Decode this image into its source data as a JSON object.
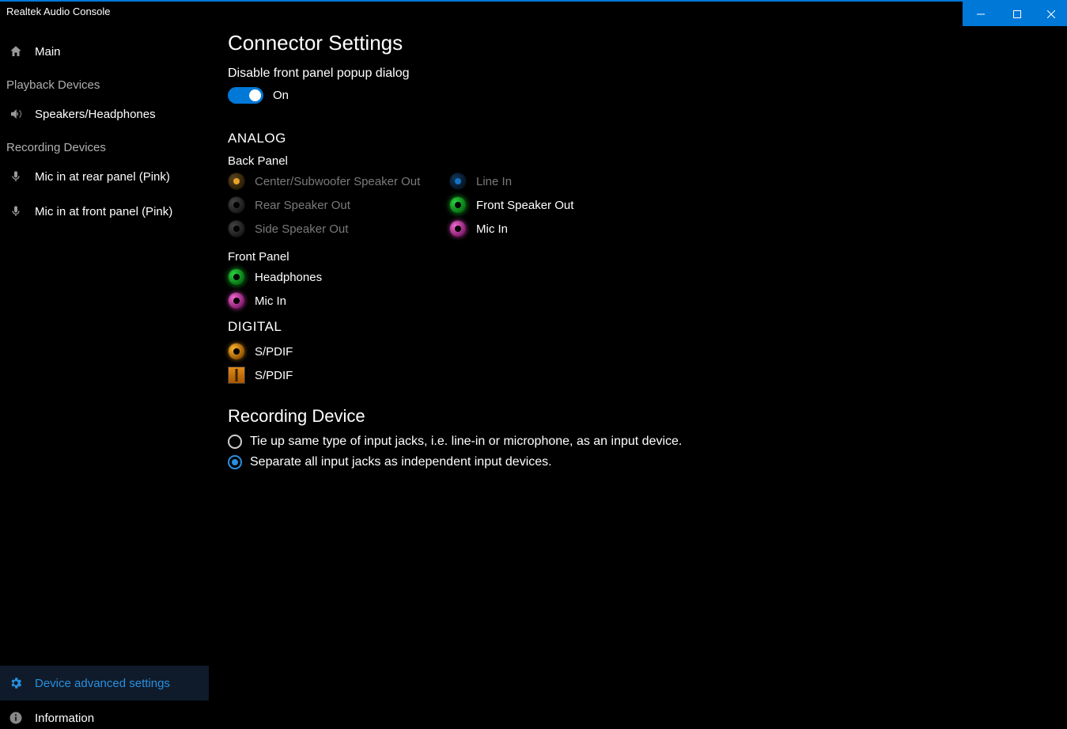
{
  "titlebar": {
    "title": "Realtek Audio Console"
  },
  "sidebar": {
    "main": "Main",
    "playback_header": "Playback Devices",
    "speakers": "Speakers/Headphones",
    "recording_header": "Recording Devices",
    "mic_rear": "Mic in at rear panel (Pink)",
    "mic_front": "Mic in at front panel (Pink)",
    "advanced": "Device advanced settings",
    "information": "Information"
  },
  "main": {
    "title": "Connector Settings",
    "disable_popup_label": "Disable front panel popup dialog",
    "toggle_state": "On",
    "analog": "ANALOG",
    "back_panel": "Back Panel",
    "front_panel": "Front Panel",
    "digital": "DIGITAL",
    "jacks": {
      "center_sub": "Center/Subwoofer Speaker Out",
      "rear_speaker": "Rear Speaker Out",
      "side_speaker": "Side Speaker Out",
      "line_in": "Line In",
      "front_speaker": "Front Speaker Out",
      "mic_in": "Mic In",
      "headphones": "Headphones",
      "mic_in_front": "Mic In",
      "spdif1": "S/PDIF",
      "spdif2": "S/PDIF"
    },
    "recording_title": "Recording Device",
    "radio1": "Tie up same type of input jacks, i.e. line-in or microphone, as an input device.",
    "radio2": "Separate all input jacks as independent input devices."
  }
}
